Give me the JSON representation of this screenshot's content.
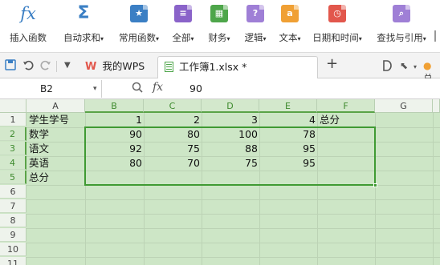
{
  "ribbon": {
    "items": [
      {
        "label": "插入函数",
        "icon": "fx-icon"
      },
      {
        "label": "自动求和",
        "icon": "sigma-icon",
        "dropdown": true
      },
      {
        "label": "常用函数",
        "icon": "star-book-icon",
        "dropdown": true
      },
      {
        "label": "全部",
        "icon": "book-icon",
        "dropdown": true
      },
      {
        "label": "财务",
        "icon": "finance-icon",
        "dropdown": true
      },
      {
        "label": "逻辑",
        "icon": "question-icon",
        "dropdown": true
      },
      {
        "label": "文本",
        "icon": "text-a-icon",
        "dropdown": true
      },
      {
        "label": "日期和时间",
        "icon": "clock-icon",
        "dropdown": true
      },
      {
        "label": "查找与引用",
        "icon": "search-book-icon",
        "dropdown": true
      }
    ],
    "fx_glyph": "fx",
    "sigma_glyph": "Σ",
    "text_glyph": "a",
    "question_glyph": "?",
    "colors": {
      "blue": "#3b7fc4",
      "purple": "#8a63c9",
      "green": "#4ea64a",
      "orange": "#f0a034",
      "red": "#e2574c",
      "lavender": "#9f7fd6"
    }
  },
  "tabs": {
    "wps_label": "我的WPS",
    "file_label": "工作簿1.xlsx *",
    "add_glyph": "+",
    "right_glyph": "总"
  },
  "formula_bar": {
    "cell_ref": "B2",
    "dropdown_glyph": "▾",
    "fx_label": "fx",
    "value": "90"
  },
  "sheet": {
    "column_headers": [
      "A",
      "B",
      "C",
      "D",
      "E",
      "F",
      "G"
    ],
    "row_headers": [
      "1",
      "2",
      "3",
      "4",
      "5",
      "6",
      "7",
      "8",
      "9",
      "10",
      "11"
    ],
    "rows": [
      [
        "学生学号",
        "1",
        "2",
        "3",
        "4",
        "总分"
      ],
      [
        "数学",
        "90",
        "80",
        "100",
        "78",
        ""
      ],
      [
        "语文",
        "92",
        "75",
        "88",
        "95",
        ""
      ],
      [
        "英语",
        "80",
        "70",
        "75",
        "95",
        ""
      ],
      [
        "总分",
        "",
        "",
        "",
        "",
        ""
      ]
    ],
    "selection": "B2:F5",
    "active_cell": "B2"
  }
}
